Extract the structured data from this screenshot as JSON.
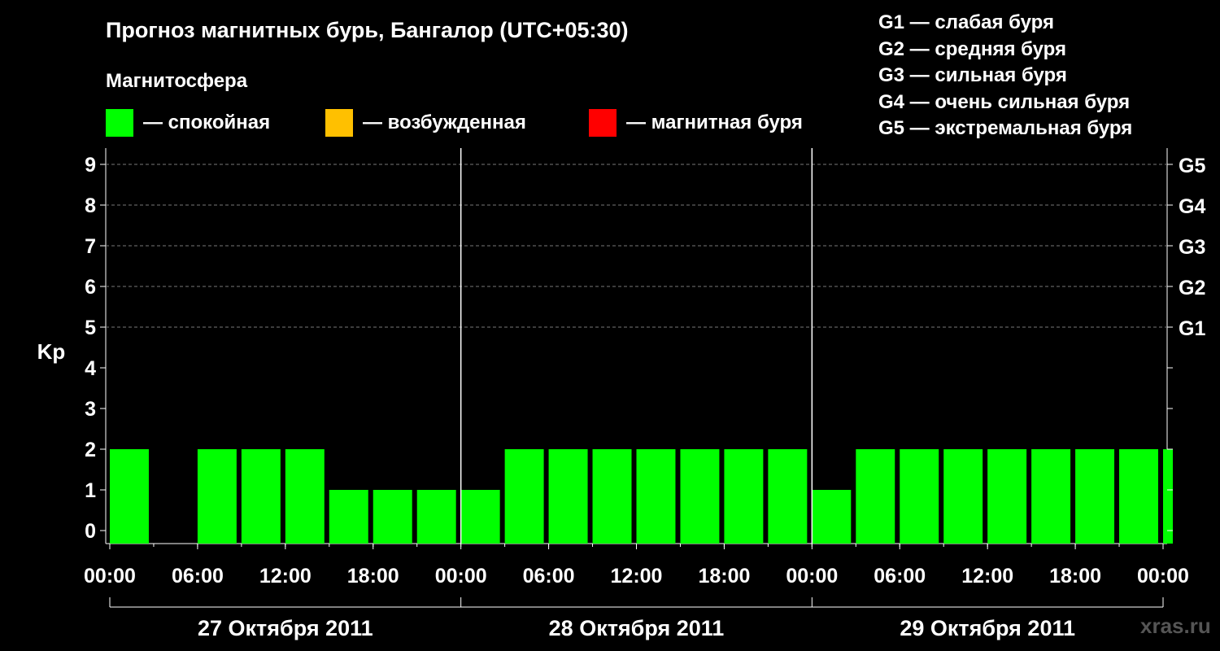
{
  "title": "Прогноз магнитных бурь, Бангалор (UTC+05:30)",
  "subtitle": "Магнитосфера",
  "legend": [
    {
      "color": "#00ff00",
      "label": "— спокойная"
    },
    {
      "color": "#ffc000",
      "label": "— возбужденная"
    },
    {
      "color": "#ff0000",
      "label": "— магнитная буря"
    }
  ],
  "g_legend": [
    "G1 — слабая буря",
    "G2 — средняя буря",
    "G3 — сильная буря",
    "G4 — очень сильная буря",
    "G5 — экстремальная буря"
  ],
  "watermark": "xras.ru",
  "chart_data": {
    "type": "bar",
    "ylabel": "Kp",
    "ylim": [
      0,
      9
    ],
    "y_ticks": [
      "0",
      "1",
      "2",
      "3",
      "4",
      "5",
      "6",
      "7",
      "8",
      "9"
    ],
    "right_axis_labels": [
      {
        "kp": 5,
        "label": "G1"
      },
      {
        "kp": 6,
        "label": "G2"
      },
      {
        "kp": 7,
        "label": "G3"
      },
      {
        "kp": 8,
        "label": "G4"
      },
      {
        "kp": 9,
        "label": "G5"
      }
    ],
    "x_tick_labels": [
      "00:00",
      "06:00",
      "12:00",
      "18:00",
      "00:00",
      "06:00",
      "12:00",
      "18:00",
      "00:00",
      "06:00",
      "12:00",
      "18:00",
      "00:00"
    ],
    "days": [
      "27 Октября 2011",
      "28 Октября 2011",
      "29 Октября 2011"
    ],
    "interval_hours": 3,
    "values": [
      2,
      0,
      2,
      2,
      2,
      1,
      1,
      1,
      1,
      2,
      2,
      2,
      2,
      2,
      2,
      2,
      1,
      2,
      2,
      2,
      2,
      2,
      2,
      2,
      2
    ],
    "grid": "dashed at Kp 5–9"
  }
}
